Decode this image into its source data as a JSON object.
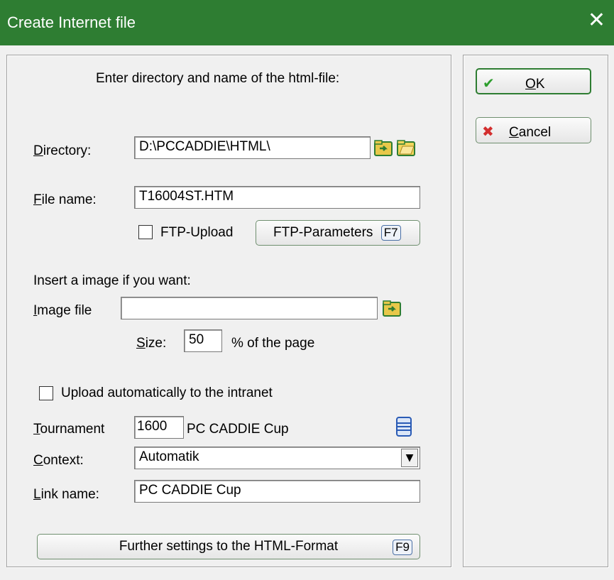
{
  "window": {
    "title": "Create Internet file",
    "close_glyph": "✕"
  },
  "intro": "Enter directory and name of the html-file:",
  "directory": {
    "label_u": "D",
    "label_rest": "irectory:",
    "value": "D:\\PCCADDIE\\HTML\\"
  },
  "filename": {
    "label_u": "F",
    "label_rest": "ile name:",
    "value": "T16004ST.HTM"
  },
  "ftp_upload": {
    "label": "FTP-Upload",
    "checked": false
  },
  "ftp_params": {
    "label": "FTP-Parameters",
    "key": "F7"
  },
  "image_section": "Insert a image if you want:",
  "image_file": {
    "label_u": "I",
    "label_rest": "mage file",
    "value": ""
  },
  "size": {
    "label_u": "S",
    "label_rest": "ize:",
    "value": "50",
    "suffix": "% of the page"
  },
  "upload_intranet": {
    "label": "Upload automatically to the intranet",
    "checked": false
  },
  "tournament": {
    "label_u": "T",
    "label_rest": "ournament",
    "id": "1600",
    "name": "PC CADDIE Cup"
  },
  "context": {
    "label_u": "C",
    "label_rest": "ontext:",
    "value": "Automatik"
  },
  "link_name": {
    "label_u": "L",
    "label_rest": "ink name:",
    "value": "PC CADDIE Cup"
  },
  "further": {
    "label": "Further settings to the HTML-Format",
    "key": "F9"
  },
  "ok": {
    "label_u": "O",
    "label_rest": "K"
  },
  "cancel": {
    "label_u": "C",
    "label_rest": "ancel"
  },
  "colors": {
    "titlebar": "#2e7d32",
    "ok_check": "#2e9e2e",
    "cancel_x": "#d32f2f"
  }
}
